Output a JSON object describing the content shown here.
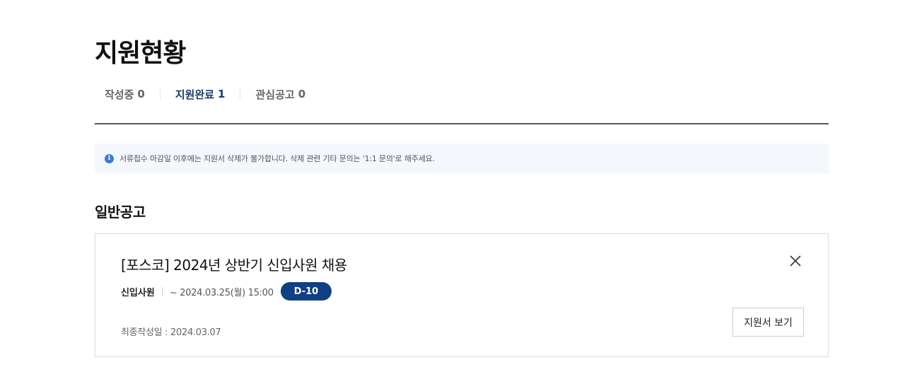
{
  "page": {
    "title": "지원현황"
  },
  "tabs": [
    {
      "label": "작성중",
      "count": "0",
      "active": false
    },
    {
      "label": "지원완료",
      "count": "1",
      "active": true
    },
    {
      "label": "관심공고",
      "count": "0",
      "active": false
    }
  ],
  "notice": {
    "icon": "info-icon",
    "icon_glyph": "i",
    "text": "서류접수 마감일 이후에는 지원서 삭제가 불가합니다. 삭제 관련 기타 문의는 '1:1 문의'로 해주세요."
  },
  "section": {
    "title": "일반공고"
  },
  "application": {
    "title": "[포스코] 2024년 상반기 신입사원 채용",
    "job_type": "신입사원",
    "deadline": "~ 2024.03.25(월) 15:00",
    "dday": "D-10",
    "updated_at": "최종작성일 : 2024.03.07",
    "view_button": "지원서 보기",
    "close_icon": "close-icon"
  },
  "colors": {
    "accent": "#0f3f84",
    "active_tab": "#1c3d6e",
    "notice_bg": "#f4f7fc",
    "info_icon": "#3a7bd5"
  }
}
